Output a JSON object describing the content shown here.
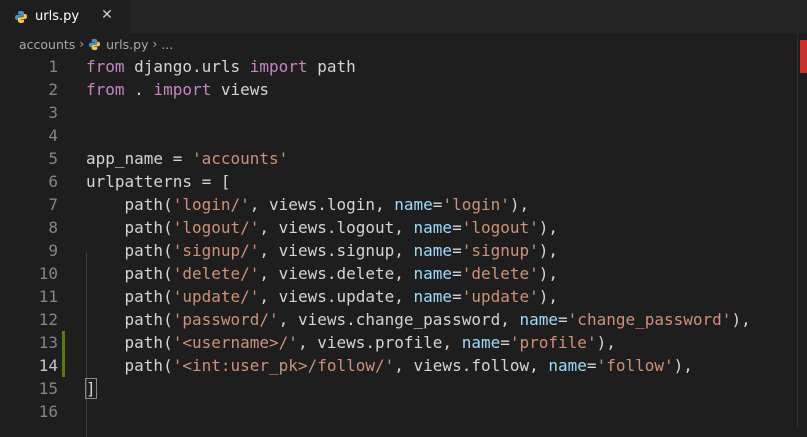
{
  "tab": {
    "label": "urls.py",
    "close": "✕"
  },
  "breadcrumb": {
    "folder": "accounts",
    "file": "urls.py",
    "more": "..."
  },
  "lines": [
    {
      "n": "1",
      "tokens": [
        {
          "t": "from",
          "c": "k"
        },
        {
          "t": " django.urls "
        },
        {
          "t": "import",
          "c": "k"
        },
        {
          "t": " path"
        }
      ]
    },
    {
      "n": "2",
      "tokens": [
        {
          "t": "from",
          "c": "k"
        },
        {
          "t": " . "
        },
        {
          "t": "import",
          "c": "k"
        },
        {
          "t": " views"
        }
      ]
    },
    {
      "n": "3",
      "tokens": []
    },
    {
      "n": "4",
      "tokens": []
    },
    {
      "n": "5",
      "tokens": [
        {
          "t": "app_name = "
        },
        {
          "t": "'accounts'",
          "c": "s"
        }
      ]
    },
    {
      "n": "6",
      "tokens": [
        {
          "t": "urlpatterns = "
        },
        {
          "t": "[",
          "c": "b"
        }
      ]
    },
    {
      "n": "7",
      "tokens": [
        {
          "t": "    path("
        },
        {
          "t": "'login/'",
          "c": "s"
        },
        {
          "t": ", views.login, "
        },
        {
          "t": "name",
          "c": "p"
        },
        {
          "t": "="
        },
        {
          "t": "'login'",
          "c": "s"
        },
        {
          "t": "),"
        }
      ]
    },
    {
      "n": "8",
      "tokens": [
        {
          "t": "    path("
        },
        {
          "t": "'logout/'",
          "c": "s"
        },
        {
          "t": ", views.logout, "
        },
        {
          "t": "name",
          "c": "p"
        },
        {
          "t": "="
        },
        {
          "t": "'logout'",
          "c": "s"
        },
        {
          "t": "),"
        }
      ]
    },
    {
      "n": "9",
      "tokens": [
        {
          "t": "    path("
        },
        {
          "t": "'signup/'",
          "c": "s"
        },
        {
          "t": ", views.signup, "
        },
        {
          "t": "name",
          "c": "p"
        },
        {
          "t": "="
        },
        {
          "t": "'signup'",
          "c": "s"
        },
        {
          "t": "),"
        }
      ]
    },
    {
      "n": "10",
      "tokens": [
        {
          "t": "    path("
        },
        {
          "t": "'delete/'",
          "c": "s"
        },
        {
          "t": ", views.delete, "
        },
        {
          "t": "name",
          "c": "p"
        },
        {
          "t": "="
        },
        {
          "t": "'delete'",
          "c": "s"
        },
        {
          "t": "),"
        }
      ]
    },
    {
      "n": "11",
      "tokens": [
        {
          "t": "    path("
        },
        {
          "t": "'update/'",
          "c": "s"
        },
        {
          "t": ", views.update, "
        },
        {
          "t": "name",
          "c": "p"
        },
        {
          "t": "="
        },
        {
          "t": "'update'",
          "c": "s"
        },
        {
          "t": "),"
        }
      ]
    },
    {
      "n": "12",
      "tokens": [
        {
          "t": "    path("
        },
        {
          "t": "'password/'",
          "c": "s"
        },
        {
          "t": ", views.change_password, "
        },
        {
          "t": "name",
          "c": "p"
        },
        {
          "t": "="
        },
        {
          "t": "'change_password'",
          "c": "s"
        },
        {
          "t": "),"
        }
      ]
    },
    {
      "n": "13",
      "tokens": [
        {
          "t": "    path("
        },
        {
          "t": "'<username>/'",
          "c": "s"
        },
        {
          "t": ", views.profile, "
        },
        {
          "t": "name",
          "c": "p"
        },
        {
          "t": "="
        },
        {
          "t": "'profile'",
          "c": "s"
        },
        {
          "t": "),"
        }
      ]
    },
    {
      "n": "14",
      "tokens": [
        {
          "t": "    path("
        },
        {
          "t": "'<int:user_pk>/follow/'",
          "c": "s"
        },
        {
          "t": ", views.follow, "
        },
        {
          "t": "name",
          "c": "p"
        },
        {
          "t": "="
        },
        {
          "t": "'follow'",
          "c": "s"
        },
        {
          "t": "),"
        }
      ]
    },
    {
      "n": "15",
      "tokens": [
        {
          "t": "]",
          "c": "b"
        }
      ]
    },
    {
      "n": "16",
      "tokens": []
    }
  ],
  "active_line": "14",
  "modified_lines": [
    "13",
    "14"
  ],
  "colors": {
    "keyword": "#c586c0",
    "string": "#ce9178",
    "param": "#9cdcfe",
    "text": "#d4d4d4"
  }
}
